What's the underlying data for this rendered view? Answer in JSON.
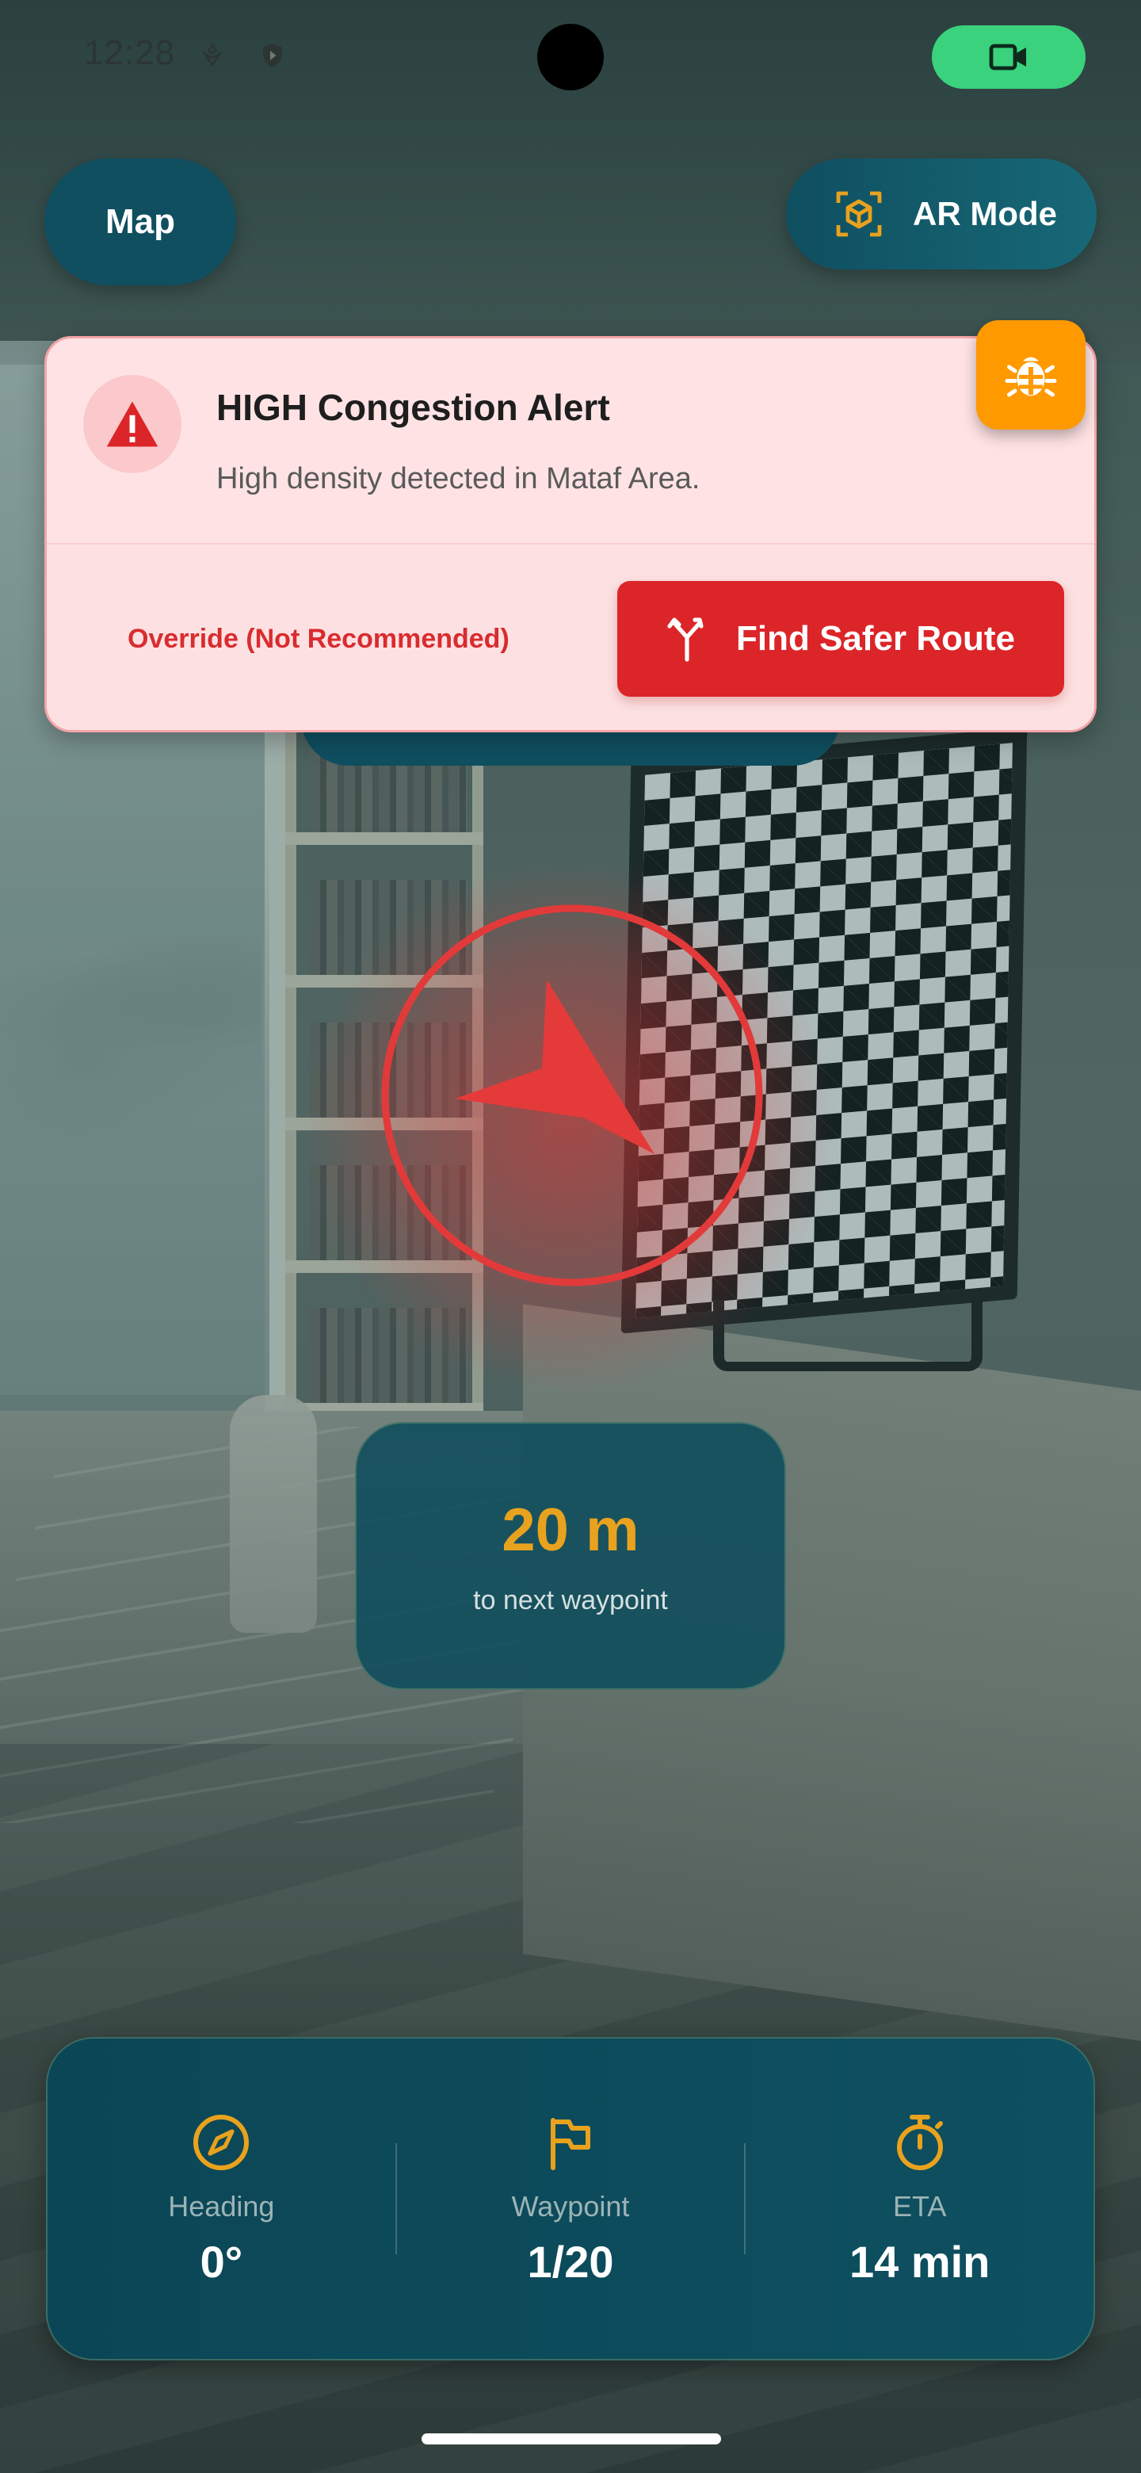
{
  "status_bar": {
    "time": "12:28",
    "icons": [
      "pinwheel-icon",
      "shield-icon",
      "video-camera-icon"
    ],
    "video_pill_color": "#3ad27d"
  },
  "top_bar": {
    "map_label": "Map",
    "ar_mode_label": "AR Mode",
    "ar_icon": "ar-cube-icon"
  },
  "alert": {
    "title": "HIGH Congestion Alert",
    "message": "High density detected in Mataf Area.",
    "icon": "warning-triangle-icon",
    "override_label": "Override (Not Recommended)",
    "safer_route_label": "Find Safer Route",
    "safer_route_icon": "route-split-icon",
    "colors": {
      "background": "#ffe3e4",
      "accent": "#dc2528"
    }
  },
  "debug_button": {
    "icon": "bug-icon",
    "color": "#ff9900"
  },
  "ar_indicator": {
    "icon": "navigation-arrow-icon",
    "color": "#e53a3a"
  },
  "distance": {
    "value": "20 m",
    "label": "to next waypoint",
    "value_color": "#e8a21e"
  },
  "stats": [
    {
      "icon": "compass-icon",
      "label": "Heading",
      "value": "0°"
    },
    {
      "icon": "flag-icon",
      "label": "Waypoint",
      "value": "1/20"
    },
    {
      "icon": "stopwatch-icon",
      "label": "ETA",
      "value": "14 min"
    }
  ],
  "theme": {
    "primary": "#0f4f60",
    "accent": "#e8a21e"
  }
}
